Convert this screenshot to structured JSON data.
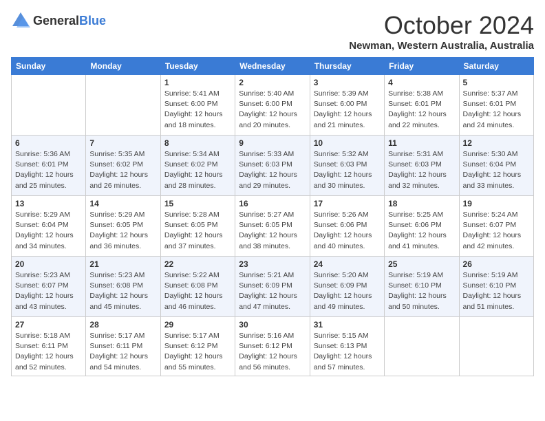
{
  "logo": {
    "general": "General",
    "blue": "Blue"
  },
  "header": {
    "month": "October 2024",
    "location": "Newman, Western Australia, Australia"
  },
  "weekdays": [
    "Sunday",
    "Monday",
    "Tuesday",
    "Wednesday",
    "Thursday",
    "Friday",
    "Saturday"
  ],
  "weeks": [
    [
      {
        "day": "",
        "sunrise": "",
        "sunset": "",
        "daylight": ""
      },
      {
        "day": "",
        "sunrise": "",
        "sunset": "",
        "daylight": ""
      },
      {
        "day": "1",
        "sunrise": "Sunrise: 5:41 AM",
        "sunset": "Sunset: 6:00 PM",
        "daylight": "Daylight: 12 hours and 18 minutes."
      },
      {
        "day": "2",
        "sunrise": "Sunrise: 5:40 AM",
        "sunset": "Sunset: 6:00 PM",
        "daylight": "Daylight: 12 hours and 20 minutes."
      },
      {
        "day": "3",
        "sunrise": "Sunrise: 5:39 AM",
        "sunset": "Sunset: 6:00 PM",
        "daylight": "Daylight: 12 hours and 21 minutes."
      },
      {
        "day": "4",
        "sunrise": "Sunrise: 5:38 AM",
        "sunset": "Sunset: 6:01 PM",
        "daylight": "Daylight: 12 hours and 22 minutes."
      },
      {
        "day": "5",
        "sunrise": "Sunrise: 5:37 AM",
        "sunset": "Sunset: 6:01 PM",
        "daylight": "Daylight: 12 hours and 24 minutes."
      }
    ],
    [
      {
        "day": "6",
        "sunrise": "Sunrise: 5:36 AM",
        "sunset": "Sunset: 6:01 PM",
        "daylight": "Daylight: 12 hours and 25 minutes."
      },
      {
        "day": "7",
        "sunrise": "Sunrise: 5:35 AM",
        "sunset": "Sunset: 6:02 PM",
        "daylight": "Daylight: 12 hours and 26 minutes."
      },
      {
        "day": "8",
        "sunrise": "Sunrise: 5:34 AM",
        "sunset": "Sunset: 6:02 PM",
        "daylight": "Daylight: 12 hours and 28 minutes."
      },
      {
        "day": "9",
        "sunrise": "Sunrise: 5:33 AM",
        "sunset": "Sunset: 6:03 PM",
        "daylight": "Daylight: 12 hours and 29 minutes."
      },
      {
        "day": "10",
        "sunrise": "Sunrise: 5:32 AM",
        "sunset": "Sunset: 6:03 PM",
        "daylight": "Daylight: 12 hours and 30 minutes."
      },
      {
        "day": "11",
        "sunrise": "Sunrise: 5:31 AM",
        "sunset": "Sunset: 6:03 PM",
        "daylight": "Daylight: 12 hours and 32 minutes."
      },
      {
        "day": "12",
        "sunrise": "Sunrise: 5:30 AM",
        "sunset": "Sunset: 6:04 PM",
        "daylight": "Daylight: 12 hours and 33 minutes."
      }
    ],
    [
      {
        "day": "13",
        "sunrise": "Sunrise: 5:29 AM",
        "sunset": "Sunset: 6:04 PM",
        "daylight": "Daylight: 12 hours and 34 minutes."
      },
      {
        "day": "14",
        "sunrise": "Sunrise: 5:29 AM",
        "sunset": "Sunset: 6:05 PM",
        "daylight": "Daylight: 12 hours and 36 minutes."
      },
      {
        "day": "15",
        "sunrise": "Sunrise: 5:28 AM",
        "sunset": "Sunset: 6:05 PM",
        "daylight": "Daylight: 12 hours and 37 minutes."
      },
      {
        "day": "16",
        "sunrise": "Sunrise: 5:27 AM",
        "sunset": "Sunset: 6:05 PM",
        "daylight": "Daylight: 12 hours and 38 minutes."
      },
      {
        "day": "17",
        "sunrise": "Sunrise: 5:26 AM",
        "sunset": "Sunset: 6:06 PM",
        "daylight": "Daylight: 12 hours and 40 minutes."
      },
      {
        "day": "18",
        "sunrise": "Sunrise: 5:25 AM",
        "sunset": "Sunset: 6:06 PM",
        "daylight": "Daylight: 12 hours and 41 minutes."
      },
      {
        "day": "19",
        "sunrise": "Sunrise: 5:24 AM",
        "sunset": "Sunset: 6:07 PM",
        "daylight": "Daylight: 12 hours and 42 minutes."
      }
    ],
    [
      {
        "day": "20",
        "sunrise": "Sunrise: 5:23 AM",
        "sunset": "Sunset: 6:07 PM",
        "daylight": "Daylight: 12 hours and 43 minutes."
      },
      {
        "day": "21",
        "sunrise": "Sunrise: 5:23 AM",
        "sunset": "Sunset: 6:08 PM",
        "daylight": "Daylight: 12 hours and 45 minutes."
      },
      {
        "day": "22",
        "sunrise": "Sunrise: 5:22 AM",
        "sunset": "Sunset: 6:08 PM",
        "daylight": "Daylight: 12 hours and 46 minutes."
      },
      {
        "day": "23",
        "sunrise": "Sunrise: 5:21 AM",
        "sunset": "Sunset: 6:09 PM",
        "daylight": "Daylight: 12 hours and 47 minutes."
      },
      {
        "day": "24",
        "sunrise": "Sunrise: 5:20 AM",
        "sunset": "Sunset: 6:09 PM",
        "daylight": "Daylight: 12 hours and 49 minutes."
      },
      {
        "day": "25",
        "sunrise": "Sunrise: 5:19 AM",
        "sunset": "Sunset: 6:10 PM",
        "daylight": "Daylight: 12 hours and 50 minutes."
      },
      {
        "day": "26",
        "sunrise": "Sunrise: 5:19 AM",
        "sunset": "Sunset: 6:10 PM",
        "daylight": "Daylight: 12 hours and 51 minutes."
      }
    ],
    [
      {
        "day": "27",
        "sunrise": "Sunrise: 5:18 AM",
        "sunset": "Sunset: 6:11 PM",
        "daylight": "Daylight: 12 hours and 52 minutes."
      },
      {
        "day": "28",
        "sunrise": "Sunrise: 5:17 AM",
        "sunset": "Sunset: 6:11 PM",
        "daylight": "Daylight: 12 hours and 54 minutes."
      },
      {
        "day": "29",
        "sunrise": "Sunrise: 5:17 AM",
        "sunset": "Sunset: 6:12 PM",
        "daylight": "Daylight: 12 hours and 55 minutes."
      },
      {
        "day": "30",
        "sunrise": "Sunrise: 5:16 AM",
        "sunset": "Sunset: 6:12 PM",
        "daylight": "Daylight: 12 hours and 56 minutes."
      },
      {
        "day": "31",
        "sunrise": "Sunrise: 5:15 AM",
        "sunset": "Sunset: 6:13 PM",
        "daylight": "Daylight: 12 hours and 57 minutes."
      },
      {
        "day": "",
        "sunrise": "",
        "sunset": "",
        "daylight": ""
      },
      {
        "day": "",
        "sunrise": "",
        "sunset": "",
        "daylight": ""
      }
    ]
  ]
}
